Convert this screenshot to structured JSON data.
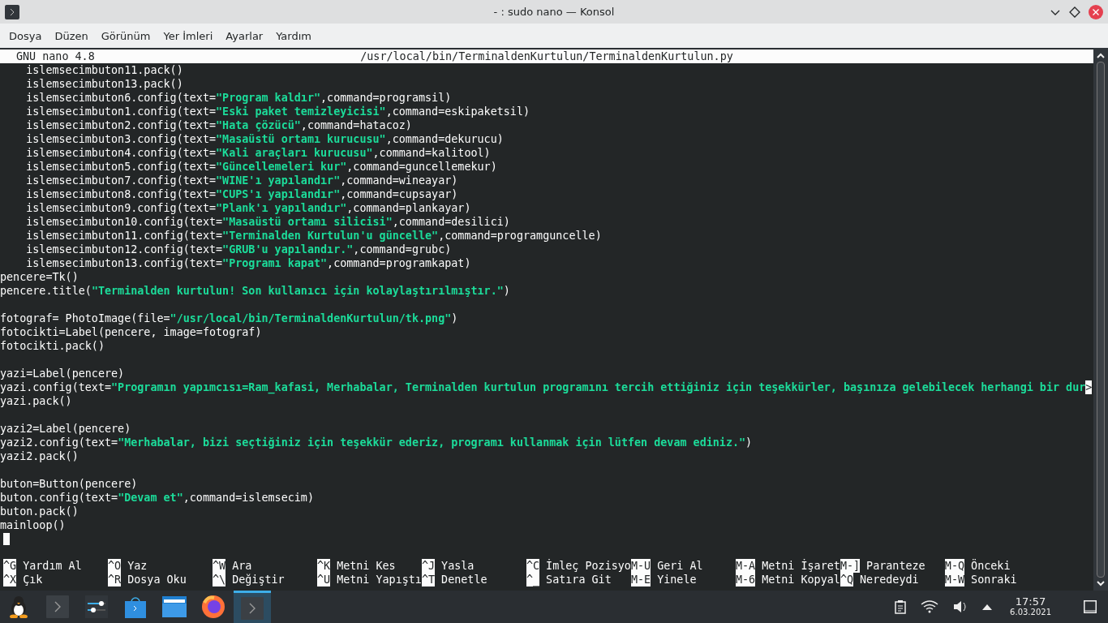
{
  "window": {
    "title": "- : sudo nano — Konsol"
  },
  "menu": [
    "Dosya",
    "Düzen",
    "Görünüm",
    "Yer İmleri",
    "Ayarlar",
    "Yardım"
  ],
  "nano_header": {
    "version": "GNU nano 4.8",
    "path": "/usr/local/bin/TerminaldenKurtulun/TerminaldenKurtulun.py"
  },
  "code_blocks": [
    [
      "    islemsecimbuton11.pack()",
      "    islemsecimbuton13.pack()",
      "    islemsecimbuton6.config(text=**\"Program kaldır\"**,command=programsil)",
      "    islemsecimbuton1.config(text=**\"Eski paket temizleyicisi\"**,command=eskipaketsil)",
      "    islemsecimbuton2.config(text=**\"Hata çözücü\"**,command=hatacoz)",
      "    islemsecimbuton3.config(text=**\"Masaüstü ortamı kurucusu\"**,command=dekurucu)",
      "    islemsecimbuton4.config(text=**\"Kali araçları kurucusu\"**,command=kalitool)",
      "    islemsecimbuton5.config(text=**\"Güncellemeleri kur\"**,command=guncellemekur)",
      "    islemsecimbuton7.config(text=**\"WINE'ı yapılandır\"**,command=wineayar)",
      "    islemsecimbuton8.config(text=**\"CUPS'ı yapılandır\"**,command=cupsayar)",
      "    islemsecimbuton9.config(text=**\"Plank'ı yapılandır\"**,command=plankayar)",
      "    islemsecimbuton10.config(text=**\"Masaüstü ortamı silicisi\"**,command=desilici)",
      "    islemsecimbuton11.config(text=**\"Terminalden Kurtulun'u güncelle\"**,command=programguncelle)",
      "    islemsecimbuton12.config(text=**\"GRUB'u yapılandır.\"**,command=grubc)",
      "    islemsecimbuton13.config(text=**\"Programı kapat\"**,command=programkapat)",
      "pencere=Tk()",
      "pencere.title(**\"Terminalden kurtulun! Son kullanıcı için kolaylaştırılmıştır.\"**)"
    ],
    [
      "fotograf= PhotoImage(file=**\"/usr/local/bin/TerminaldenKurtulun/tk.png\"**)",
      "fotocikti=Label(pencere, image=fotograf)",
      "fotocikti.pack()"
    ],
    [
      "yazi=Label(pencere)",
      {
        "text": "yazi.config(text=**\"Programın yapımcısı=Ram_kafasi, Merhabalar, Terminalden kurtulun programını tercih ettiğiniz için teşekkürler, başınıza gelebilecek herhangi bir dur**",
        "overflow_marker": ">"
      },
      "yazi.pack()"
    ],
    [
      "yazi2=Label(pencere)",
      "yazi2.config(text=**\"Merhabalar, bizi seçtiğiniz için teşekkür ederiz, programı kullanmak için lütfen devam ediniz.\"**)",
      "yazi2.pack()"
    ],
    [
      "buton=Button(pencere)",
      "buton.config(text=**\"Devam et\"**,command=islemsecim)",
      "buton.pack()",
      "mainloop()"
    ]
  ],
  "shortcuts": [
    [
      {
        "key": "^G",
        "label": "Yardım Al"
      },
      {
        "key": "^O",
        "label": "Yaz"
      },
      {
        "key": "^W",
        "label": "Ara"
      },
      {
        "key": "^K",
        "label": "Metni Kes"
      },
      {
        "key": "^J",
        "label": "Yasla"
      },
      {
        "key": "^C",
        "label": "İmleç Pozisyo"
      },
      {
        "key": "M-U",
        "label": "Geri Al"
      },
      {
        "key": "M-A",
        "label": "Metni İşaret"
      },
      {
        "key": "M-]",
        "label": "Paranteze"
      },
      {
        "key": "M-Q",
        "label": "Önceki"
      }
    ],
    [
      {
        "key": "^X",
        "label": "Çık"
      },
      {
        "key": "^R",
        "label": "Dosya Oku"
      },
      {
        "key": "^\\",
        "label": "Değiştir"
      },
      {
        "key": "^U",
        "label": "Metni Yapıştı"
      },
      {
        "key": "^T",
        "label": "Denetle"
      },
      {
        "key": "^_",
        "label": "Satıra Git"
      },
      {
        "key": "M-E",
        "label": "Yinele"
      },
      {
        "key": "M-6",
        "label": "Metni Kopyal"
      },
      {
        "key": "^Q",
        "label": "Neredeydi"
      },
      {
        "key": "M-W",
        "label": "Sonraki"
      }
    ]
  ],
  "taskbar": [
    {
      "kind": "tux",
      "selected": false
    },
    {
      "kind": "terminal",
      "selected": false
    },
    {
      "kind": "sliders",
      "selected": false
    },
    {
      "kind": "store",
      "selected": false
    },
    {
      "kind": "folder",
      "selected": false
    },
    {
      "kind": "browser",
      "selected": false
    },
    {
      "kind": "terminal",
      "selected": true
    }
  ],
  "clock": {
    "time": "17:57",
    "date": "6.03.2021"
  }
}
